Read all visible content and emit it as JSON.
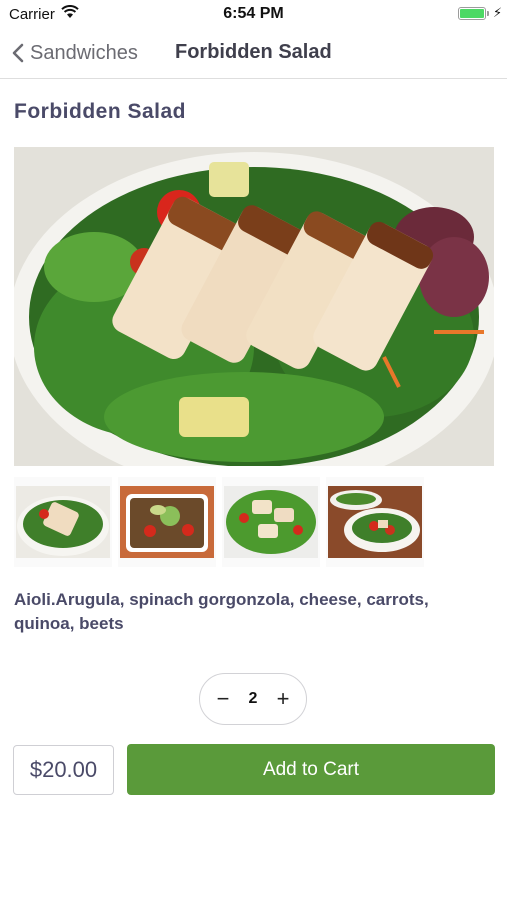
{
  "status_bar": {
    "carrier": "Carrier",
    "time": "6:54 PM",
    "battery_level": 1.0
  },
  "nav": {
    "back_label": "Sandwiches",
    "title": "Forbidden Salad"
  },
  "product": {
    "title": "Forbidden Salad",
    "description": "Aioli.Arugula, spinach gorgonzola, cheese, carrots, quinoa, beets",
    "quantity": "2",
    "price": "$20.00",
    "add_to_cart_label": "Add to Cart",
    "decrement_symbol": "−",
    "increment_symbol": "+"
  },
  "colors": {
    "accent": "#5a9a3a",
    "text": "#4a4a68",
    "battery": "#4cd964"
  }
}
